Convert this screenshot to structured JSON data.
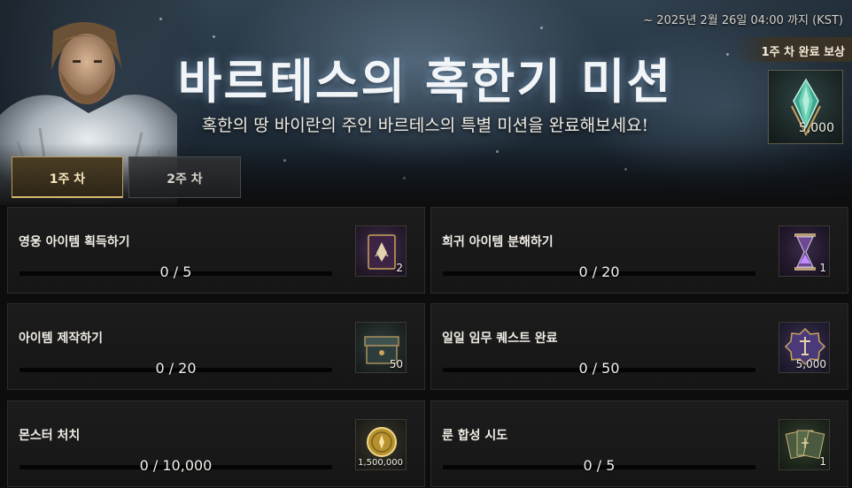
{
  "banner": {
    "deadline": "~ 2025년 2월 26일 04:00 까지 (KST)",
    "title": "바르테스의 혹한기 미션",
    "subtitle": "혹한의 땅 바이란의 주인 바르테스의 특별 미션을 완료해보세요!",
    "reward_label": "1주 차 완료 보상",
    "reward_qty": "5,000",
    "reward_icon": "crystal-icon"
  },
  "tabs": [
    {
      "label": "1주 차",
      "active": true
    },
    {
      "label": "2주 차",
      "active": false
    }
  ],
  "missions": [
    {
      "title": "영웅 아이템 획득하기",
      "progress": "0 / 5",
      "ratio": 0,
      "reward_qty": "2",
      "reward_icon": "purple-book-icon"
    },
    {
      "title": "희귀 아이템 분해하기",
      "progress": "0 / 20",
      "ratio": 0,
      "reward_qty": "1",
      "reward_icon": "hourglass-icon"
    },
    {
      "title": "아이템 제작하기",
      "progress": "0 / 20",
      "ratio": 0,
      "reward_qty": "50",
      "reward_icon": "chest-icon"
    },
    {
      "title": "일일 임무 퀘스트 완료",
      "progress": "0 / 50",
      "ratio": 0,
      "reward_qty": "5,000",
      "reward_icon": "badge-icon"
    },
    {
      "title": "몬스터 처치",
      "progress": "0 / 10,000",
      "ratio": 0,
      "reward_qty": "1,500,000",
      "reward_icon": "gold-coin-icon"
    },
    {
      "title": "룬 합성 시도",
      "progress": "0 / 5",
      "ratio": 0,
      "reward_qty": "1",
      "reward_icon": "rune-cards-icon"
    }
  ],
  "colors": {
    "accent_gold": "#d9b86b",
    "panel_bg": "#1a1a1b",
    "page_bg": "#0d0d0e"
  }
}
